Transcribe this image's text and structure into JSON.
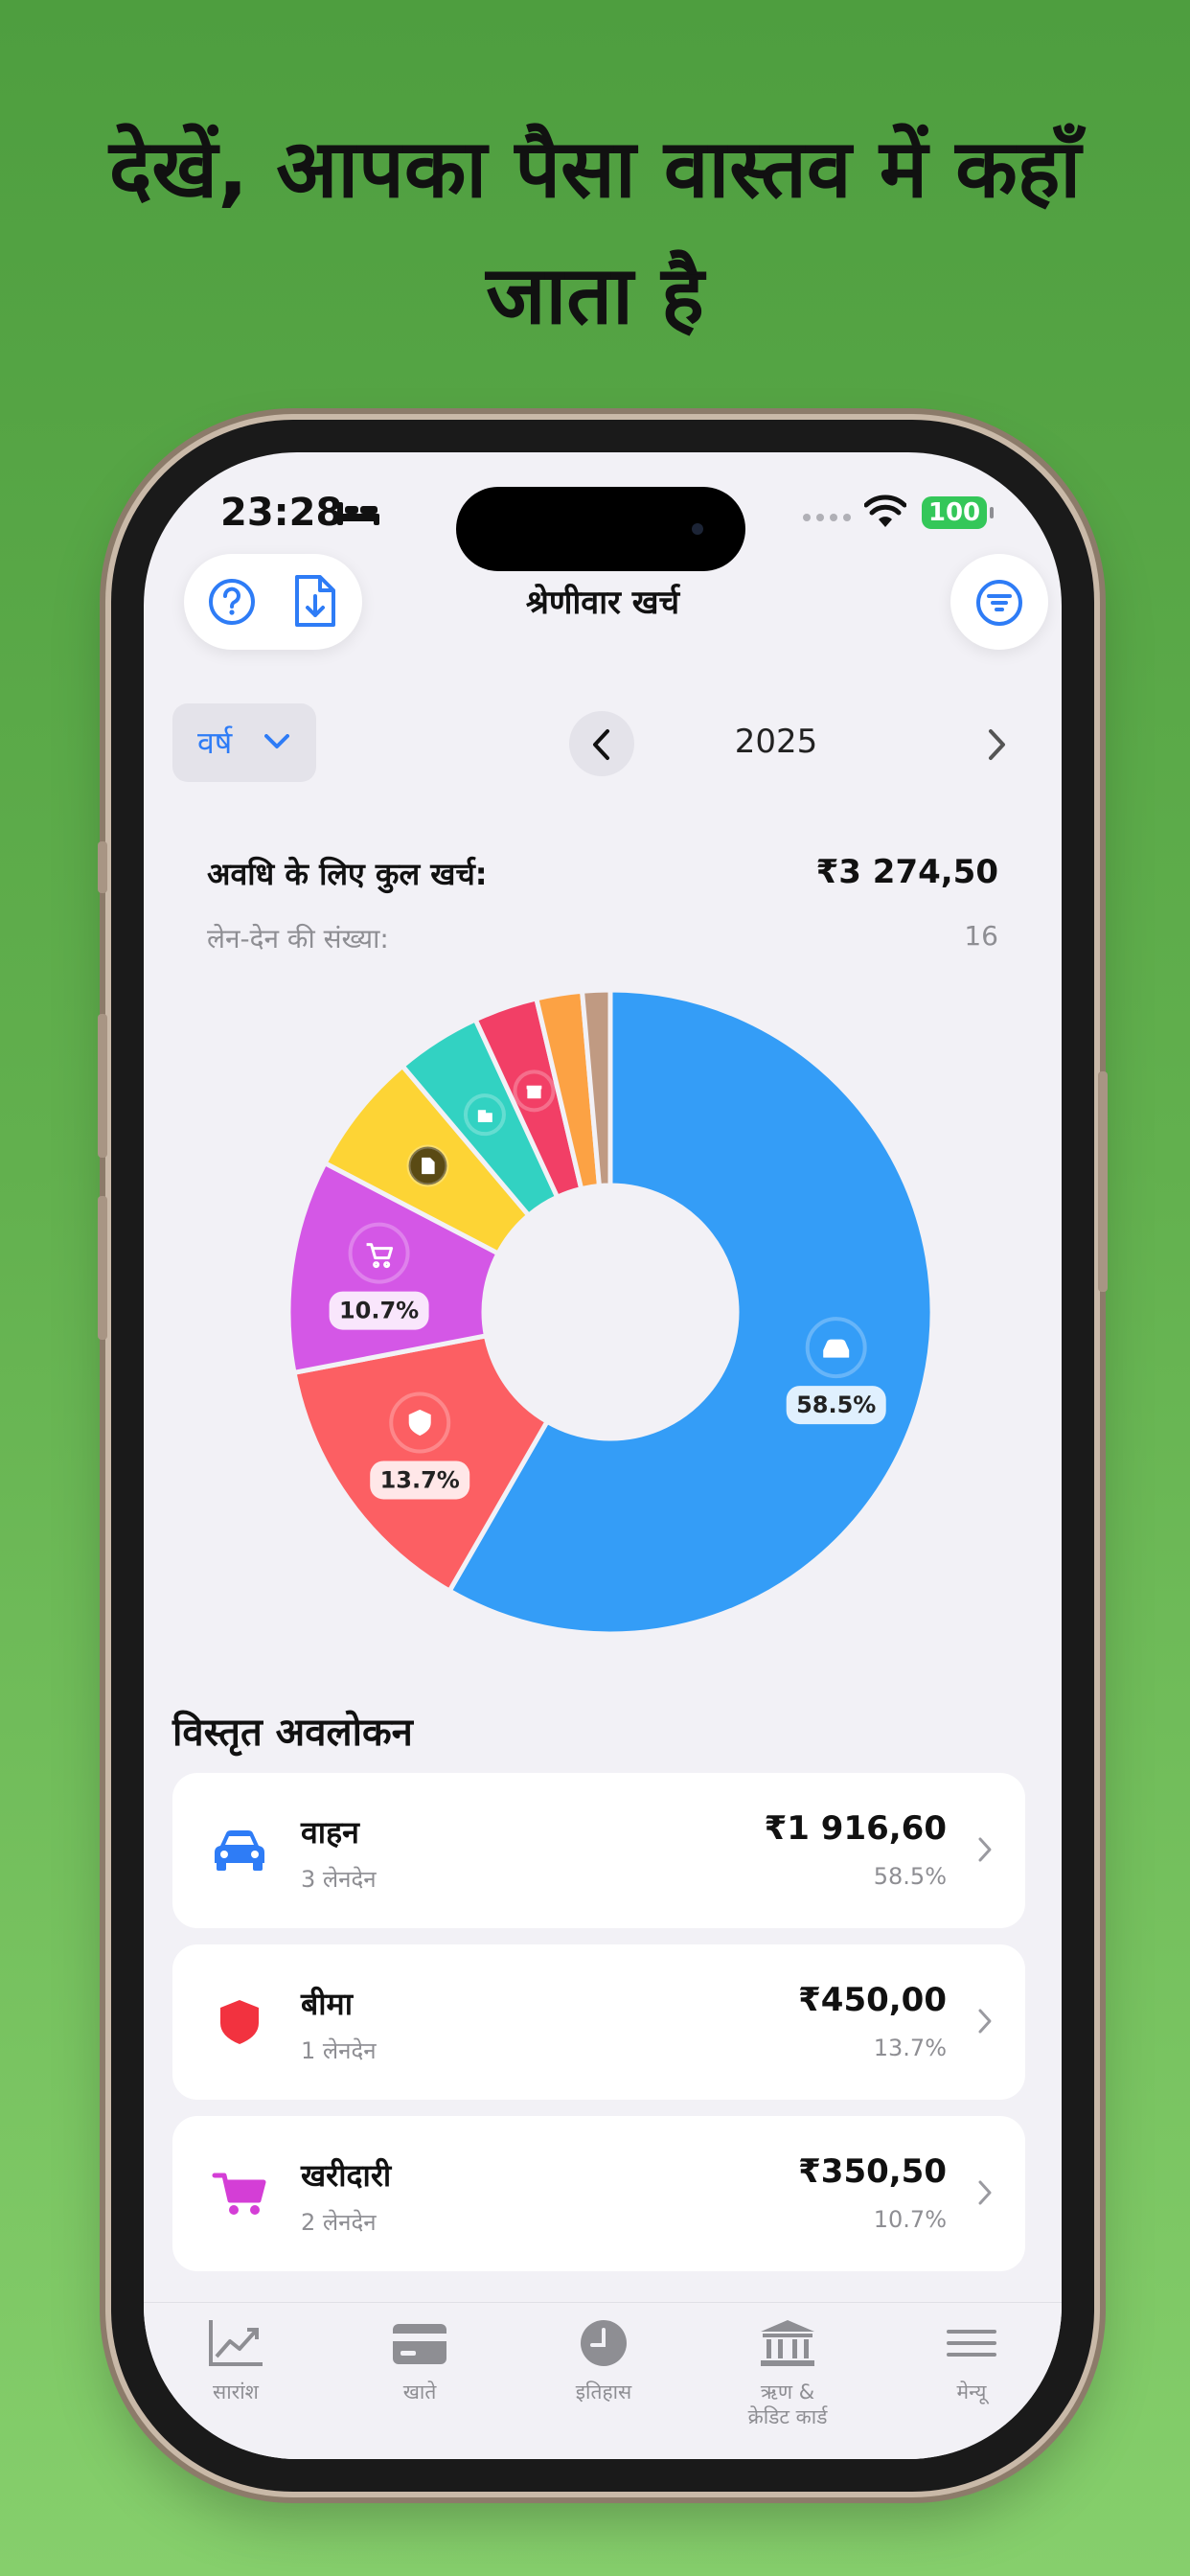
{
  "headline": "देखें, आपका पैसा वास्तव में कहाँ जाता है",
  "status_bar": {
    "time": "23:28",
    "battery": "100"
  },
  "nav": {
    "title": "श्रेणीवार खर्च"
  },
  "icons": {
    "help": "help-circle-icon",
    "export": "file-download-icon",
    "filter": "filter-lines-icon"
  },
  "period": {
    "segment_label": "वर्ष",
    "year": "2025"
  },
  "summary": {
    "total_label": "अवधि के लिए कुल खर्च:",
    "total_value": "₹3 274,50",
    "count_label": "लेन-देन की संख्या:",
    "count_value": "16"
  },
  "chart_data": {
    "type": "pie",
    "donut": true,
    "slices": [
      {
        "category": "वाहन",
        "percent": 58.5,
        "color": "#349df7",
        "icon": "car-icon",
        "label": "58.5%"
      },
      {
        "category": "बीमा",
        "percent": 13.7,
        "color": "#fc5f63",
        "icon": "shield-icon",
        "label": "13.7%"
      },
      {
        "category": "खरीदारी",
        "percent": 10.7,
        "color": "#d457e6",
        "icon": "cart-icon",
        "label": "10.7%"
      },
      {
        "category": "",
        "percent": 6.2,
        "color": "#fdd435",
        "icon": "document-icon",
        "label": ""
      },
      {
        "category": "",
        "percent": 4.3,
        "color": "#32d2c2",
        "icon": "gift-boxes-icon",
        "label": ""
      },
      {
        "category": "",
        "percent": 3.2,
        "color": "#f23f66",
        "icon": "gift-icon",
        "label": ""
      },
      {
        "category": "",
        "percent": 2.3,
        "color": "#fca244",
        "icon": "",
        "label": ""
      },
      {
        "category": "",
        "percent": 1.4,
        "color": "#c09a82",
        "icon": "",
        "label": ""
      }
    ]
  },
  "details": {
    "title": "विस्तृत अवलोकन",
    "items": [
      {
        "name": "वाहन",
        "sub": "3 लेनदेन",
        "amount": "₹1 916,60",
        "percent": "58.5%",
        "icon": "car-icon",
        "color": "#2e7cf6"
      },
      {
        "name": "बीमा",
        "sub": "1 लेनदेन",
        "amount": "₹450,00",
        "percent": "13.7%",
        "icon": "shield-icon",
        "color": "#f2323f"
      },
      {
        "name": "खरीदारी",
        "sub": "2 लेनदेन",
        "amount": "₹350,50",
        "percent": "10.7%",
        "icon": "cart-icon",
        "color": "#d43ed6"
      }
    ]
  },
  "tabs": [
    {
      "label": "सारांश",
      "icon": "chart-trend-icon"
    },
    {
      "label": "खाते",
      "icon": "card-icon"
    },
    {
      "label": "इतिहास",
      "icon": "clock-icon"
    },
    {
      "label": "ऋण & क्रेडिट कार्ड",
      "label_line1": "ऋण &",
      "label_line2": "क्रेडिट कार्ड",
      "icon": "bank-icon"
    },
    {
      "label": "मेन्यू",
      "icon": "menu-icon"
    }
  ]
}
